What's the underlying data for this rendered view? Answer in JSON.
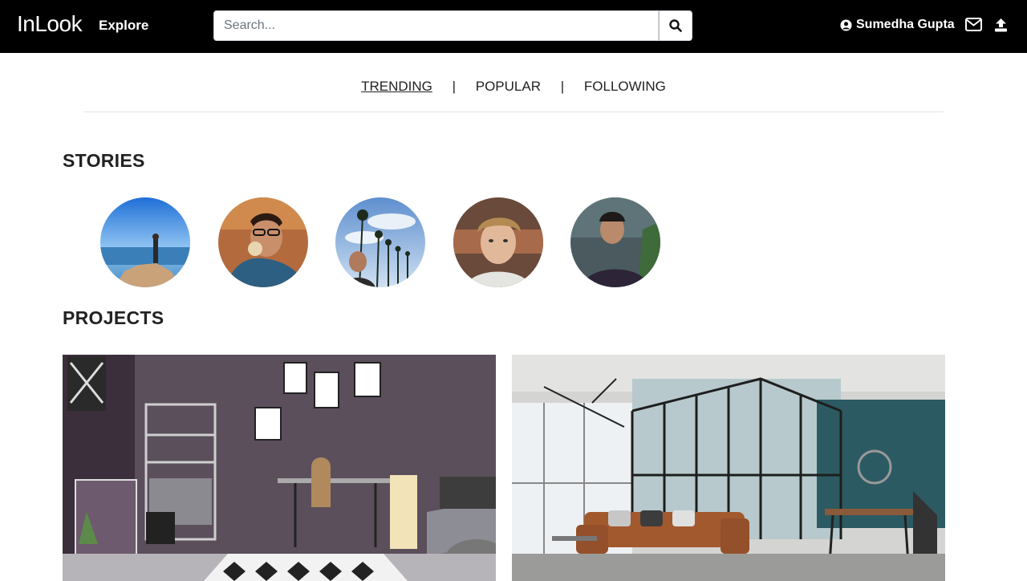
{
  "navbar": {
    "brand": "InLook",
    "explore_label": "Explore",
    "search_placeholder": "Search...",
    "user_name": "Sumedha Gupta"
  },
  "tabs": [
    {
      "label": "TRENDING",
      "active": true
    },
    {
      "label": "POPULAR",
      "active": false
    },
    {
      "label": "FOLLOWING",
      "active": false
    }
  ],
  "tab_separator": "|",
  "sections": {
    "stories_title": "STORIES",
    "projects_title": "PROJECTS"
  },
  "icons": {
    "search": "search-icon",
    "user": "user-circle-icon",
    "mail": "envelope-icon",
    "upload": "upload-icon"
  },
  "colors": {
    "navbar_bg": "#000000",
    "page_bg": "#ffffff"
  }
}
